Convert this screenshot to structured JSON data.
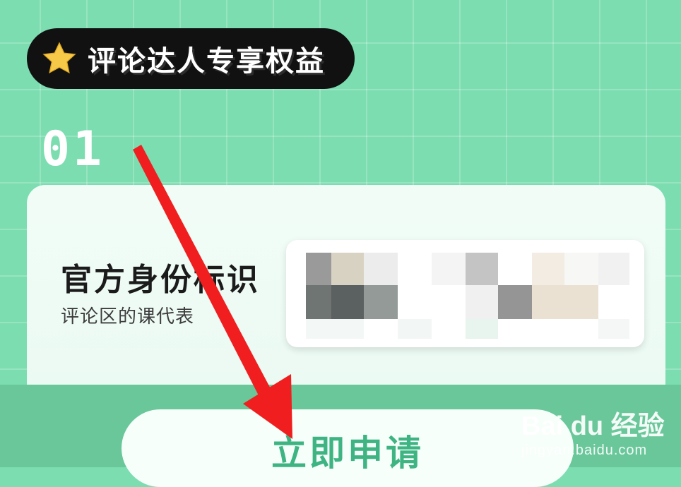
{
  "header": {
    "title": "评论达人专享权益",
    "icon": "star-icon"
  },
  "section": {
    "number": "01"
  },
  "card": {
    "title": "官方身份标识",
    "subtitle": "评论区的课代表"
  },
  "action": {
    "apply_label": "立即申请"
  },
  "watermark": {
    "brand": "Bai du 经验",
    "url": "jingyan.baidu.com"
  },
  "colors": {
    "background": "#7bddb0",
    "pill": "#111111",
    "accent": "#3fb483",
    "arrow": "#f01e1e"
  }
}
